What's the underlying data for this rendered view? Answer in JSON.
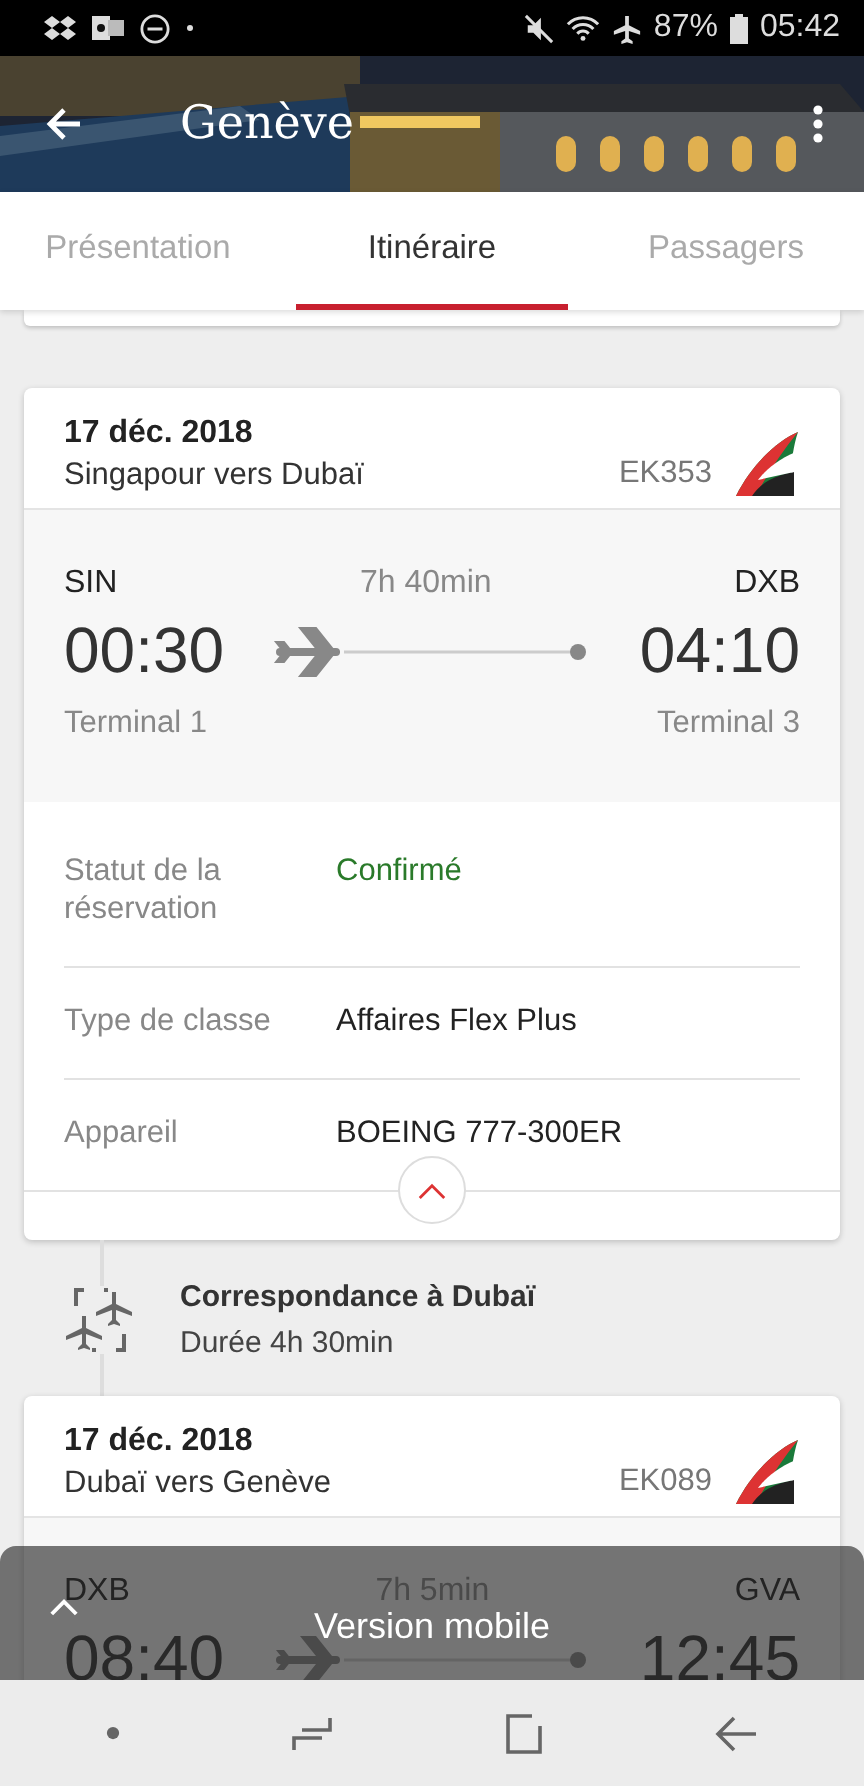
{
  "status_bar": {
    "battery": "87%",
    "time": "05:42"
  },
  "header": {
    "title": "Genève"
  },
  "tabs": [
    {
      "label": "Présentation",
      "selected": false
    },
    {
      "label": "Itinéraire",
      "selected": true
    },
    {
      "label": "Passagers",
      "selected": false
    }
  ],
  "flights": [
    {
      "date": "17 déc. 2018",
      "route": "Singapour vers Dubaï",
      "flight_number": "EK353",
      "from_code": "SIN",
      "to_code": "DXB",
      "duration": "7h 40min",
      "departure": "00:30",
      "arrival": "04:10",
      "from_terminal": "Terminal 1",
      "to_terminal": "Terminal 3",
      "details": [
        {
          "label": "Statut de la réservation",
          "value": "Confirmé",
          "kind": "status"
        },
        {
          "label": "Type de classe",
          "value": "Affaires Flex Plus",
          "kind": "text"
        },
        {
          "label": "Appareil",
          "value": "BOEING 777-300ER",
          "kind": "text"
        }
      ],
      "expanded": true
    },
    {
      "date": "17 déc. 2018",
      "route": "Dubaï vers Genève",
      "flight_number": "EK089",
      "from_code": "DXB",
      "to_code": "GVA",
      "duration": "7h 5min",
      "departure": "08:40",
      "arrival": "12:45"
    }
  ],
  "connection": {
    "title": "Correspondance à Dubaï",
    "duration": "Durée 4h 30min"
  },
  "banner": {
    "label": "Version mobile"
  }
}
